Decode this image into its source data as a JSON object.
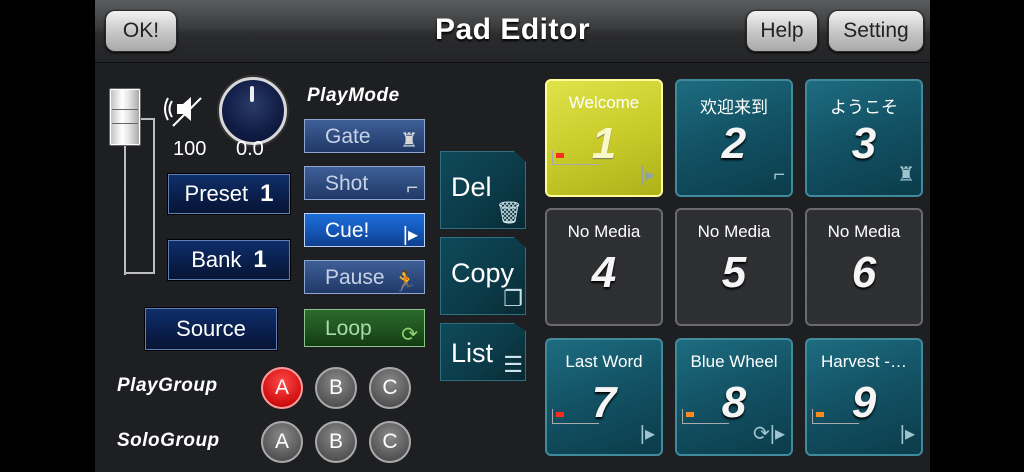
{
  "header": {
    "title": "Pad Editor",
    "ok_label": "OK!",
    "help_label": "Help",
    "setting_label": "Setting"
  },
  "audio": {
    "volume": "100",
    "pan": "0.0"
  },
  "preset": {
    "label": "Preset",
    "number": "1"
  },
  "bank": {
    "label": "Bank",
    "number": "1"
  },
  "source_label": "Source",
  "playmode": {
    "title": "PlayMode",
    "gate": "Gate",
    "shot": "Shot",
    "cue": "Cue!",
    "pause": "Pause",
    "loop": "Loop"
  },
  "actions": {
    "del": "Del",
    "copy": "Copy",
    "list": "List"
  },
  "groups": {
    "play_title": "PlayGroup",
    "solo_title": "SoloGroup",
    "a": "A",
    "b": "B",
    "c": "C",
    "play_selected": "A"
  },
  "pads": [
    {
      "title": "Welcome",
      "number": "1",
      "state": "selected",
      "icon": "play-arrow-icon"
    },
    {
      "title": "欢迎来到",
      "number": "2",
      "state": "media",
      "icon": "gun-icon"
    },
    {
      "title": "ようこそ",
      "number": "3",
      "state": "media",
      "icon": "lantern-icon"
    },
    {
      "title": "No Media",
      "number": "4",
      "state": "empty"
    },
    {
      "title": "No Media",
      "number": "5",
      "state": "empty"
    },
    {
      "title": "No Media",
      "number": "6",
      "state": "empty"
    },
    {
      "title": "Last Word",
      "number": "7",
      "state": "media",
      "icon": "play-arrow-icon"
    },
    {
      "title": "Blue Wheel",
      "number": "8",
      "state": "media",
      "icon": "loop-play-icon"
    },
    {
      "title": "Harvest -…",
      "number": "9",
      "state": "media",
      "icon": "play-arrow-icon"
    }
  ]
}
